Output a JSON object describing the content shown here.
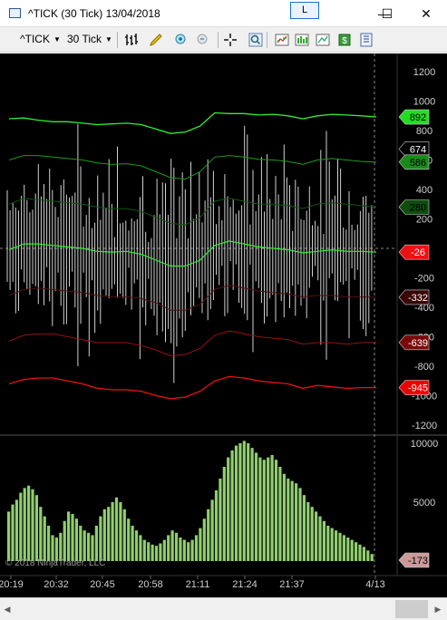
{
  "window": {
    "title": "^TICK (30 Tick)  13/04/2018",
    "link_label": "L",
    "minimize_glyph": "—",
    "maximize_glyph": "☐",
    "close_glyph": "✕"
  },
  "toolbar": {
    "instrument_label": "^TICK",
    "interval_label": "30 Tick",
    "icons": [
      "bar-type-icon",
      "drawing-tool-icon",
      "zoom-in-icon",
      "zoom-out-icon",
      "crosshair-icon",
      "magnifier-icon",
      "indicators-icon",
      "strategies-icon",
      "chart-template-icon",
      "order-entry-icon",
      "properties-icon"
    ]
  },
  "chart": {
    "watermark": "© 2018 NinjaTrader, LLC",
    "price_axis_labels": [
      "1200",
      "1000",
      "800",
      "600",
      "400",
      "200",
      "0",
      "-200",
      "-400",
      "-600",
      "-800",
      "-1000",
      "-1200"
    ],
    "volume_axis_labels": [
      "10000",
      "5000",
      "0"
    ],
    "time_labels": [
      "20:19",
      "20:32",
      "20:45",
      "20:58",
      "21:11",
      "21:24",
      "21:37",
      "4/13"
    ],
    "price_markers": [
      {
        "label": "892",
        "color": "#22dd22",
        "text_color": "#000000"
      },
      {
        "label": "674",
        "color": "#000000",
        "text_color": "#ffffff"
      },
      {
        "label": "586",
        "color": "#1a8a1a",
        "text_color": "#000000"
      },
      {
        "label": "280",
        "color": "#0f4d0f",
        "text_color": "#000000"
      },
      {
        "label": "-26",
        "color": "#ee1111",
        "text_color": "#ffffff"
      },
      {
        "label": "-332",
        "color": "#3a0505",
        "text_color": "#ffffff"
      },
      {
        "label": "-639",
        "color": "#7a0a0a",
        "text_color": "#ffffff"
      },
      {
        "label": "-945",
        "color": "#ee0000",
        "text_color": "#ffffff"
      }
    ],
    "volume_marker": {
      "label": "-173",
      "color": "#cc9999"
    },
    "colors": {
      "background": "#000000",
      "band_upper_bright": "#33ee33",
      "band_upper_mid": "#1f9a1f",
      "band_upper_dark": "#115511",
      "band_lower_bright": "#ee1111",
      "band_lower_mid": "#991111",
      "band_lower_dark": "#551111",
      "bars": "#d0d0d0",
      "volume": "#8fcf6f"
    },
    "chart_data": {
      "type": "bar",
      "price_scale": [
        -1200,
        1200
      ],
      "volume_scale": [
        0,
        10000
      ],
      "upper_band_1": [
        880,
        885,
        870,
        860,
        860,
        850,
        840,
        845,
        850,
        840,
        810,
        780,
        790,
        830,
        920,
        915,
        915,
        905,
        910,
        900,
        880,
        900,
        910,
        905,
        900,
        892
      ],
      "upper_band_2": [
        600,
        630,
        630,
        620,
        610,
        600,
        580,
        570,
        575,
        560,
        520,
        480,
        470,
        520,
        620,
        630,
        620,
        605,
        600,
        590,
        570,
        600,
        610,
        600,
        590,
        586
      ],
      "upper_band_3": [
        300,
        340,
        330,
        320,
        310,
        300,
        280,
        270,
        270,
        250,
        210,
        170,
        160,
        210,
        320,
        340,
        320,
        300,
        300,
        290,
        270,
        300,
        310,
        300,
        290,
        280
      ],
      "mid_line": [
        -10,
        30,
        30,
        20,
        10,
        0,
        -20,
        -25,
        -20,
        -40,
        -80,
        -120,
        -120,
        -80,
        20,
        50,
        30,
        10,
        0,
        -10,
        -30,
        -20,
        -10,
        -20,
        -20,
        -26
      ],
      "lower_band_3": [
        -320,
        -280,
        -270,
        -280,
        -290,
        -300,
        -320,
        -330,
        -330,
        -340,
        -370,
        -420,
        -420,
        -380,
        -280,
        -250,
        -270,
        -290,
        -300,
        -310,
        -330,
        -320,
        -320,
        -330,
        -330,
        -332
      ],
      "lower_band_2": [
        -630,
        -590,
        -580,
        -580,
        -600,
        -620,
        -640,
        -640,
        -640,
        -660,
        -690,
        -730,
        -720,
        -680,
        -590,
        -560,
        -580,
        -600,
        -610,
        -620,
        -650,
        -640,
        -640,
        -650,
        -640,
        -639
      ],
      "lower_band_1": [
        -920,
        -890,
        -880,
        -880,
        -900,
        -920,
        -950,
        -960,
        -960,
        -970,
        -1000,
        -1020,
        -1010,
        -970,
        -900,
        -870,
        -880,
        -900,
        -910,
        -920,
        -950,
        -930,
        -940,
        -950,
        -945,
        -945
      ],
      "volume_profile": [
        4200,
        4800,
        5200,
        5800,
        6200,
        6400,
        6100,
        5600,
        4600,
        3800,
        3000,
        2200,
        2000,
        2400,
        3400,
        4200,
        4000,
        3600,
        3000,
        2600,
        2400,
        2200,
        3000,
        3800,
        4400,
        4600,
        5000,
        5400,
        5000,
        4400,
        3600,
        3000,
        2600,
        2200,
        1800,
        1600,
        1400,
        1300,
        1500,
        1800,
        2200,
        2600,
        2400,
        2000,
        1800,
        1600,
        1800,
        2200,
        2800,
        3600,
        4400,
        5200,
        6000,
        7000,
        8000,
        8800,
        9400,
        9800,
        10000,
        10200,
        10000,
        9600,
        9200,
        8800,
        8600,
        8800,
        9000,
        8600,
        8000,
        7400,
        7000,
        6800,
        6600,
        6200,
        5600,
        5000,
        4600,
        4200,
        3800,
        3400,
        3000,
        2800,
        2600,
        2400,
        2200,
        2000,
        1800,
        1600,
        1400,
        1200,
        900,
        600
      ]
    }
  }
}
